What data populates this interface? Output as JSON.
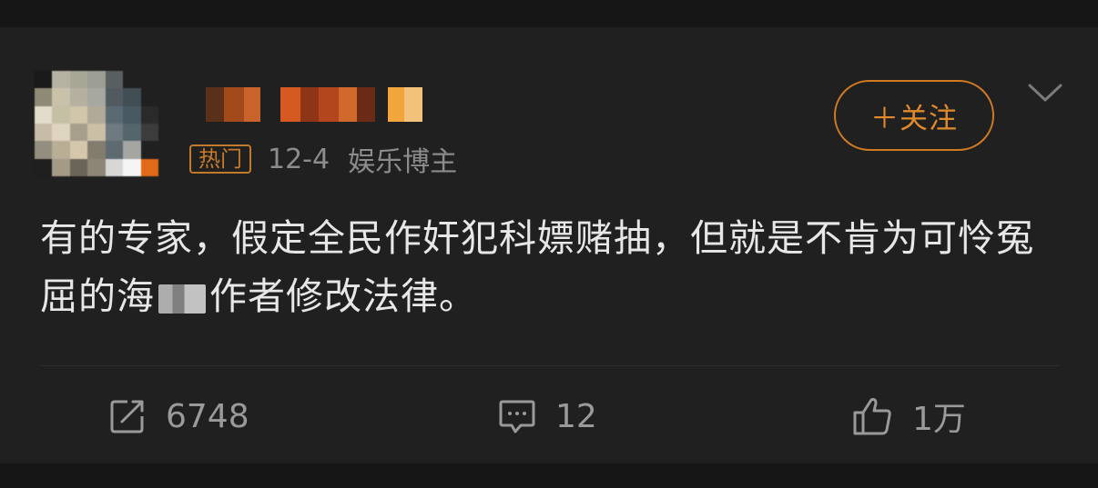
{
  "user": {
    "name": "",
    "badge": "热门",
    "time": "12-4",
    "role": "娱乐博主"
  },
  "follow_button": {
    "label": "＋关注"
  },
  "post": {
    "text_before_mosaic": "有的专家，假定全民作奸犯科嫖赌抽，但就是不肯为可怜冤屈的海",
    "text_after_mosaic": "作者修改法律。"
  },
  "actions": {
    "repost_count": "6748",
    "comment_count": "12",
    "like_count": "1万"
  },
  "colors": {
    "background": "#161616",
    "card": "#202020",
    "accent": "#d07a24",
    "text": "#e7e7e7",
    "muted": "#8c8c8c"
  },
  "icons": {
    "repost": "share-icon",
    "comment": "comment-icon",
    "like": "thumbs-up-icon",
    "more": "chevron-down-icon"
  }
}
